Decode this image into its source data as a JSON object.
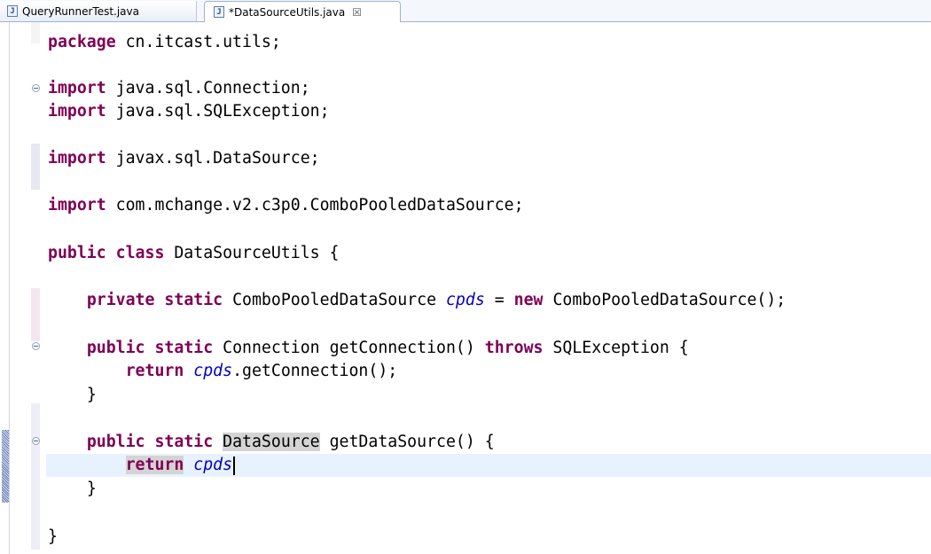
{
  "tabs": [
    {
      "label": "QueryRunnerTest.java",
      "icon": "java-file-icon",
      "active": false
    },
    {
      "label": "*DataSourceUtils.java",
      "icon": "java-file-icon",
      "active": true,
      "close": "☒"
    }
  ],
  "icons": {
    "java_file_glyph": "J"
  },
  "code": {
    "pkg_kw": "package",
    "pkg_name": " cn.itcast.utils;",
    "import_kw": "import",
    "import1": " java.sql.Connection;",
    "import2": " java.sql.SQLException;",
    "import3": " javax.sql.DataSource;",
    "import4": " com.mchange.v2.c3p0.ComboPooledDataSource;",
    "public_kw": "public",
    "class_kw": "class",
    "class_name": " DataSourceUtils {",
    "private_kw": "private",
    "static_kw": "static",
    "new_kw": "new",
    "return_kw": "return",
    "throws_kw": "throws",
    "field_name": "cpds",
    "l10_type": " ComboPooledDataSource ",
    "l10_assign": " = ",
    "l10_ctor": " ComboPooledDataSource();",
    "l12_sig": " Connection getConnection() ",
    "l12_exc": " SQLException {",
    "l13_call": ".getConnection();",
    "close_brace": "}",
    "l16_type": "DataSource",
    "l16_sig": " getDataSource() {"
  },
  "colors": {
    "keyword": "#7f0055",
    "field": "#0000c0",
    "current_line": "#e8f2fe",
    "occurrence": "#d4d4d4"
  }
}
